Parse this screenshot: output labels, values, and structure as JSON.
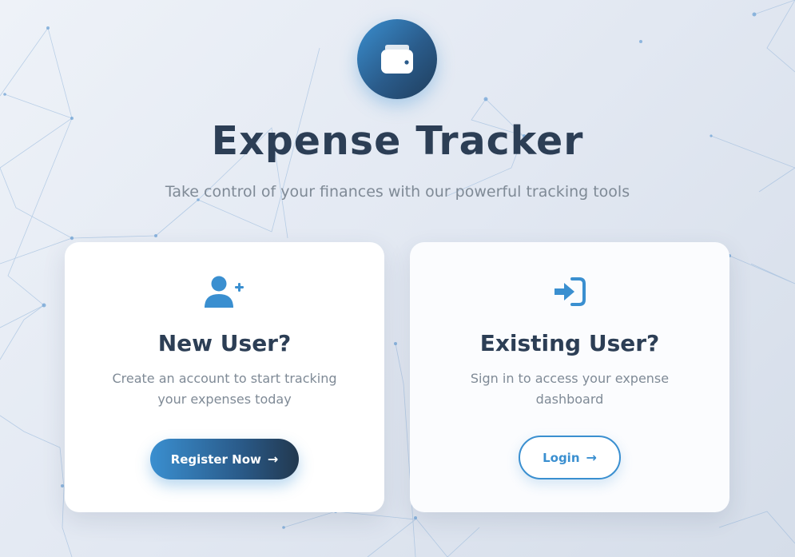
{
  "header": {
    "title": "Expense Tracker",
    "subtitle": "Take control of your finances with our powerful tracking tools",
    "logo_icon": "wallet-icon"
  },
  "cards": {
    "new_user": {
      "icon": "user-plus-icon",
      "title": "New User?",
      "description": "Create an account to start tracking your expenses today",
      "button_label": "Register Now",
      "button_icon": "arrow-right-icon"
    },
    "existing_user": {
      "icon": "sign-in-icon",
      "title": "Existing User?",
      "description": "Sign in to access your expense dashboard",
      "button_label": "Login",
      "button_icon": "arrow-right-icon"
    }
  },
  "colors": {
    "accent": "#3a8fd0",
    "accent_dark": "#22384f",
    "title_text": "#2c3e55",
    "muted_text": "#7f8a96",
    "background": "#e2e8f2"
  }
}
